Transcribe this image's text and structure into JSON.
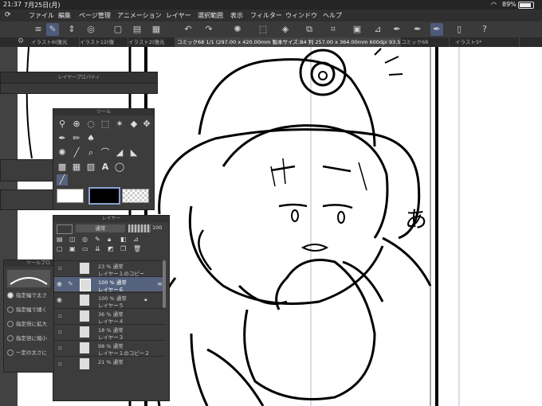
{
  "status": {
    "time": "21:37",
    "date": "7月25日(月)",
    "battery": "89%",
    "icons": [
      "wifi-icon",
      "battery-icon"
    ]
  },
  "menu": {
    "items": [
      "ファイル",
      "編集",
      "ページ管理",
      "アニメーション",
      "レイヤー",
      "選択範囲",
      "表示",
      "フィルター",
      "ウィンドウ",
      "ヘルプ"
    ]
  },
  "tabs": [
    {
      "label": "イラスト6(復元"
    },
    {
      "label": "イラスト12(復"
    },
    {
      "label": "イラスト2(復元"
    },
    {
      "label": "コミック68 1/1 (297.00 x 420.00mm 製本サイズ:B4 判 257.00 x 364.00mm 600dpi 93.5%)",
      "active": true
    },
    {
      "label": "コミック68"
    },
    {
      "label": "イラスト5*"
    }
  ],
  "layer_props_panel": {
    "title": "レイヤープロパティ"
  },
  "tool_panel": {
    "title": "ツール"
  },
  "layer_panel": {
    "title": "レイヤー",
    "blend_mode": "通常",
    "opacity": "100",
    "layers": [
      {
        "percent": "23 % 通常",
        "name": "レイヤー１のコピー",
        "visible": false,
        "selected": false
      },
      {
        "percent": "100 % 通常",
        "name": "レイヤー６",
        "visible": true,
        "selected": true
      },
      {
        "percent": "100 % 通常",
        "name": "レイヤー５",
        "visible": true,
        "selected": false
      },
      {
        "percent": "36 % 通常",
        "name": "レイヤー４",
        "visible": false,
        "selected": false
      },
      {
        "percent": "18 % 通常",
        "name": "レイヤー３",
        "visible": false,
        "selected": false
      },
      {
        "percent": "98 % 通常",
        "name": "レイヤー１のコピー２",
        "visible": false,
        "selected": false
      },
      {
        "percent": "21 % 通常",
        "name": "",
        "visible": false,
        "selected": false
      }
    ]
  },
  "tool_property_panel": {
    "title": "ツールプロ",
    "options": [
      "指定幅で太さ",
      "指定幅で細く",
      "指定倍に拡大",
      "指定倍に縮小",
      "一定の太さに"
    ]
  },
  "canvas": {
    "sfx": "あ"
  },
  "colors": {
    "accent": "#55627d",
    "panel": "#3c3c3c",
    "chrome": "#2f2f2f"
  }
}
